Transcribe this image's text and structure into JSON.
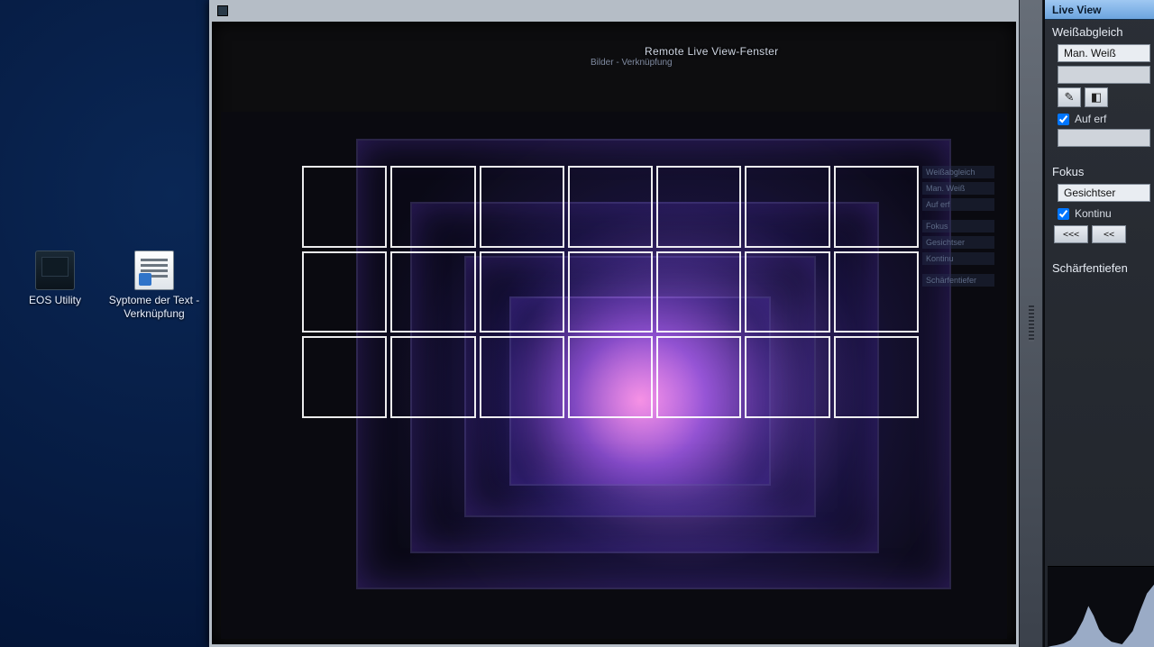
{
  "desktop": {
    "icons": [
      {
        "name": "eos",
        "label": "EOS Utility"
      },
      {
        "name": "text",
        "label": "Syptome der Text - Verknüpfung"
      }
    ]
  },
  "live_view_window": {
    "title": "Remote Live View-Fenster",
    "inner_breadcrumb": "Bilder - Verknüpfung",
    "af_grid": {
      "rows": 3,
      "cols": 7
    },
    "reflected_panel": {
      "weissabgleich_label": "Weißabgleich",
      "man_weiss_label": "Man. Weiß",
      "auf_erf_label": "Auf erf",
      "fokus_label": "Fokus",
      "gesichtser_label": "Gesichtser",
      "kontinu_label": "Kontinu",
      "schaerfentiefer_label": "Schärfentiefer"
    }
  },
  "panel": {
    "header_button": "Live View",
    "weissabgleich": {
      "title": "Weißabgleich",
      "dropdown_value": "Man. Weiß",
      "eyedropper_tooltip": "Pipette",
      "checkbox_auf_erf": {
        "label": "Auf erf",
        "checked": true
      }
    },
    "fokus": {
      "title": "Fokus",
      "mode_value": "Gesichtser",
      "checkbox_kontinu": {
        "label": "Kontinu",
        "checked": true
      },
      "arrows_left": "<<<",
      "arrows_left2": "<<"
    },
    "schaerfentiefen": {
      "title": "Schärfentiefen"
    }
  }
}
